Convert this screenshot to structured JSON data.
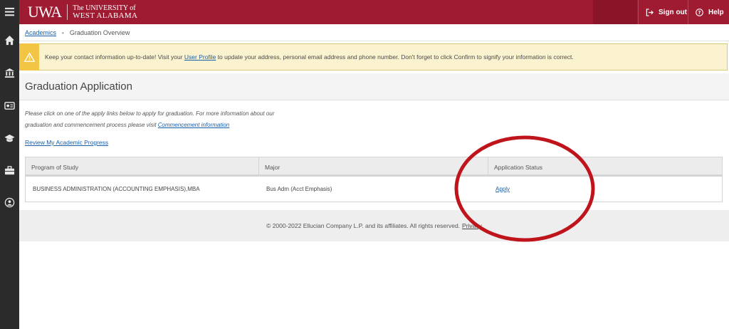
{
  "header": {
    "logo_mark": "UWA",
    "logo_line1": "The UNIVERSITY of",
    "logo_line2": "WEST ALABAMA",
    "sign_out_label": "Sign out",
    "help_label": "Help",
    "brand_color": "#9e1b32"
  },
  "sidebar": {
    "items": [
      {
        "icon": "menu-icon"
      },
      {
        "icon": "home-icon"
      },
      {
        "icon": "bank-icon"
      },
      {
        "icon": "id-card-icon"
      },
      {
        "icon": "graduation-cap-icon"
      },
      {
        "icon": "briefcase-icon"
      },
      {
        "icon": "user-icon"
      }
    ]
  },
  "breadcrumb": {
    "root_label": "Academics",
    "current_label": "Graduation Overview"
  },
  "notice": {
    "text_before": "Keep your contact information up-to-date! Visit your ",
    "link_label": "User Profile",
    "text_after": " to update your address, personal email address and phone number. Don't forget to click Confirm to signify your information is correct."
  },
  "page": {
    "title": "Graduation Application",
    "intro_line1": "Please click on one of the apply links below to apply for graduation. For more information about our",
    "intro_line2": "graduation and commencement process please visit ",
    "intro_link": "Commencement information",
    "progress_link": "Review My Academic Progress"
  },
  "table": {
    "headers": [
      "Program of Study",
      "Major",
      "Application Status"
    ],
    "rows": [
      {
        "program": "BUSINESS ADMINISTRATION (ACCOUNTING EMPHASIS),MBA",
        "major": "Bus Adm (Acct Emphasis)",
        "status": "Apply"
      }
    ]
  },
  "footer": {
    "copyright": "© 2000-2022 Ellucian Company L.P. and its affiliates. All rights reserved.",
    "privacy_label": "Privacy"
  },
  "annotation": {
    "color": "#c0141c"
  }
}
